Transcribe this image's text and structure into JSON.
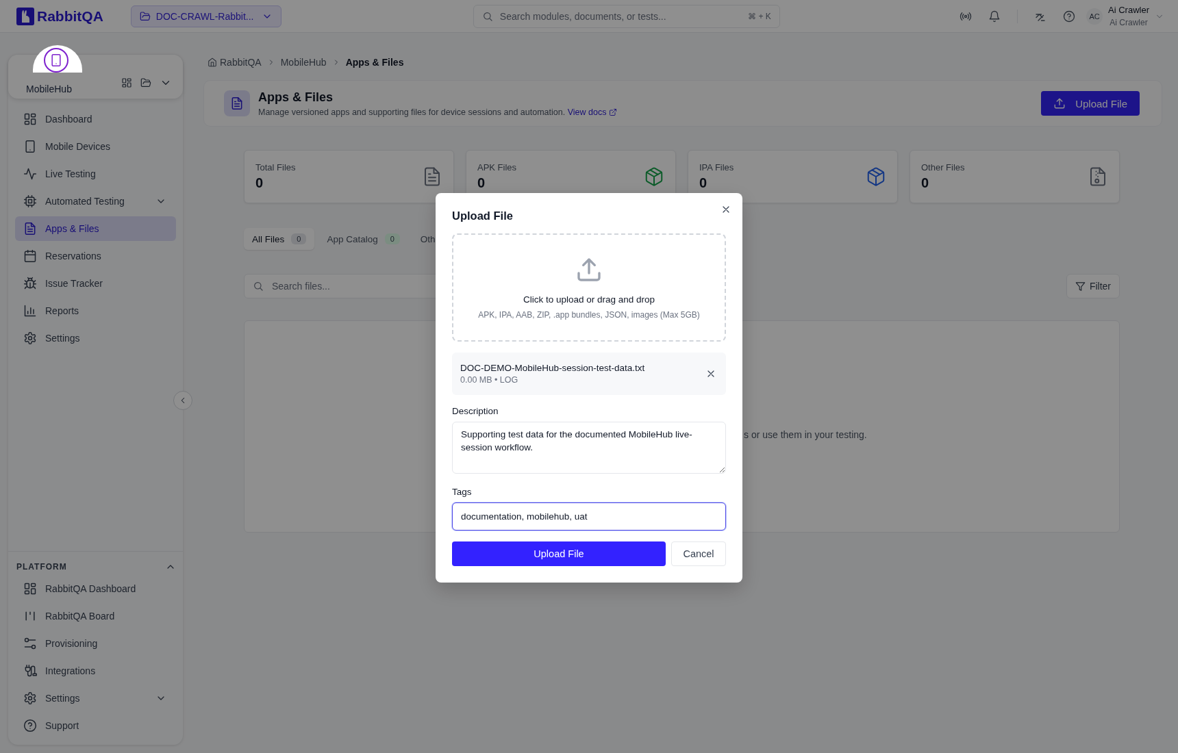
{
  "topbar": {
    "logo": "RabbitQA",
    "project": "DOC-CRAWL-Rabbit...",
    "search_placeholder": "Search modules, documents, or tests...",
    "shortcut": "⌘ + K",
    "user": {
      "initials": "AC",
      "name": "Ai Crawler",
      "role": "Ai Crawler"
    }
  },
  "sidebar": {
    "module": "MobileHub",
    "items": [
      {
        "label": "Dashboard",
        "kind": "grid",
        "selected": false,
        "has_submenu": false
      },
      {
        "label": "Mobile Devices",
        "kind": "phone",
        "selected": false,
        "has_submenu": false
      },
      {
        "label": "Live Testing",
        "kind": "pulse",
        "selected": false,
        "has_submenu": false
      },
      {
        "label": "Automated Testing",
        "kind": "chip",
        "selected": false,
        "has_submenu": true
      },
      {
        "label": "Apps & Files",
        "kind": "doc",
        "selected": true,
        "has_submenu": false
      },
      {
        "label": "Reservations",
        "kind": "calendar",
        "selected": false,
        "has_submenu": false
      },
      {
        "label": "Issue Tracker",
        "kind": "bug",
        "selected": false,
        "has_submenu": false
      },
      {
        "label": "Reports",
        "kind": "chart",
        "selected": false,
        "has_submenu": false
      },
      {
        "label": "Settings",
        "kind": "gear",
        "selected": false,
        "has_submenu": false
      }
    ],
    "section": {
      "title": "PLATFORM",
      "expanded": true,
      "items": [
        {
          "label": "RabbitQA Dashboard",
          "kind": "grid",
          "selected": false,
          "has_submenu": false
        },
        {
          "label": "RabbitQA Board",
          "kind": "board",
          "selected": false,
          "has_submenu": false
        },
        {
          "label": "Provisioning",
          "kind": "sliders",
          "selected": false,
          "has_submenu": false
        },
        {
          "label": "Integrations",
          "kind": "plug",
          "selected": false,
          "has_submenu": false
        },
        {
          "label": "Settings",
          "kind": "gear",
          "selected": false,
          "has_submenu": true
        },
        {
          "label": "Support",
          "kind": "help",
          "selected": false,
          "has_submenu": false
        }
      ]
    }
  },
  "breadcrumb": [
    "RabbitQA",
    "MobileHub",
    "Apps & Files"
  ],
  "page": {
    "title": "Apps & Files",
    "description": "Manage versioned apps and supporting files for device sessions and automation.",
    "link": "View docs",
    "button": "Upload File"
  },
  "stats": [
    {
      "label": "Total Files",
      "value": "0",
      "kind": "total"
    },
    {
      "label": "APK Files",
      "value": "0",
      "kind": "apk"
    },
    {
      "label": "IPA Files",
      "value": "0",
      "kind": "ipa"
    },
    {
      "label": "Other Files",
      "value": "0",
      "kind": "other"
    }
  ],
  "tabs": [
    {
      "label": "All Files",
      "count": "0",
      "selected": true,
      "kind": "all"
    },
    {
      "label": "App Catalog",
      "count": "0",
      "selected": false,
      "kind": "catalog"
    },
    {
      "label": "Oth",
      "selected": false
    }
  ],
  "search": {
    "placeholder": "Search files..."
  },
  "filter": "Filter",
  "empty_text": "s or use them in your testing.",
  "modal": {
    "title": "Upload File",
    "drop_title": "Click to upload or drag and drop",
    "drop_hint": "APK, IPA, AAB, ZIP, .app bundles, JSON, images (Max 5GB)",
    "file": {
      "name": "DOC-DEMO-MobileHub-session-test-data.txt",
      "meta": "0.00 MB • LOG"
    },
    "description": {
      "label": "Description",
      "value": "Supporting test data for the documented MobileHub live-session workflow."
    },
    "tags": {
      "label": "Tags",
      "value": "documentation, mobilehub, uat",
      "focused": true
    },
    "submit": "Upload File",
    "cancel": "Cancel"
  }
}
